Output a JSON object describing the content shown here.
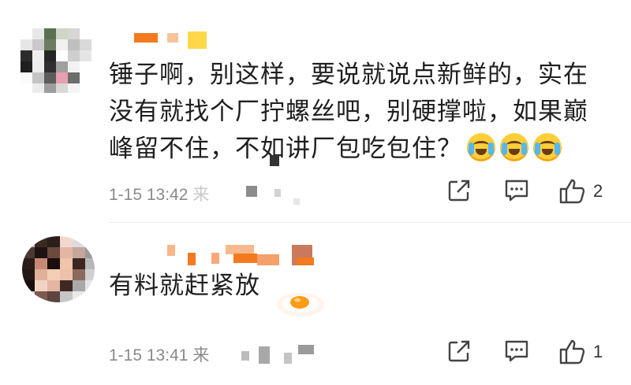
{
  "comments": [
    {
      "text_lines": [
        "锤子啊，别这样，要说就说点新鲜的，实在",
        "没有就找个厂拧螺丝吧，别硬撑啦，如果巅",
        "峰留不住，不如讲厂包吃包住？"
      ],
      "emojis": [
        "cry-laugh-emoji",
        "cry-laugh-emoji",
        "cry-laugh-emoji"
      ],
      "time": "1-15 13:42",
      "source": "来",
      "likes": "2"
    },
    {
      "text": "有料就赶紧放",
      "sticker": "fried-egg-icon",
      "time": "1-15 13:41",
      "source": "来",
      "likes": "1"
    }
  ],
  "icons": {
    "share": "share-icon",
    "comment": "comment-icon",
    "like": "thumbs-up-icon"
  },
  "colors": {
    "nickname_orange": "#f47a20",
    "nickname_yellow": "#ffc928",
    "meta_gray": "#8a8a8a"
  }
}
